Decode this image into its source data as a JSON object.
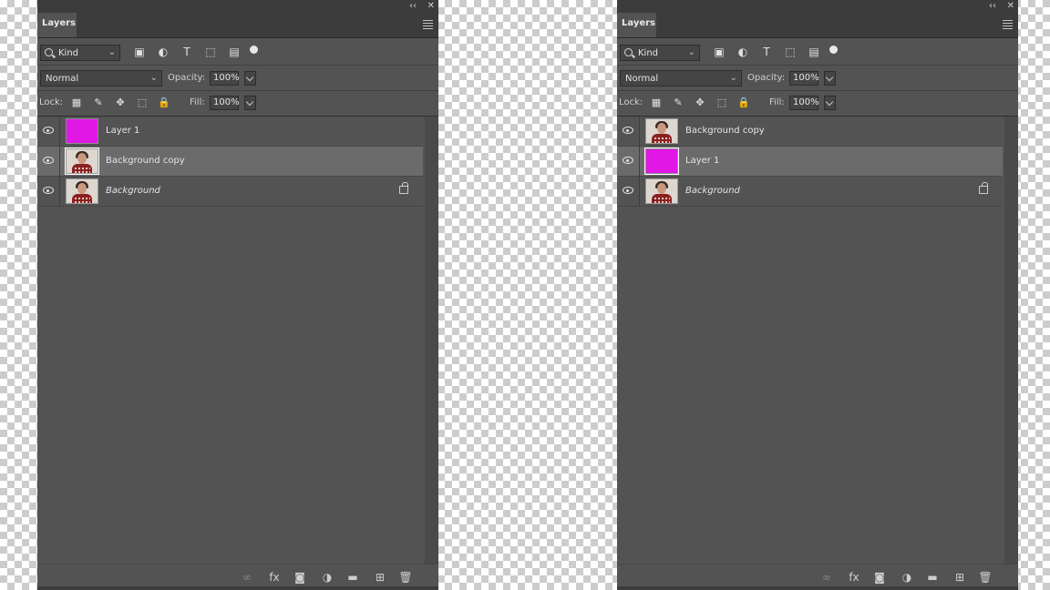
{
  "panels": [
    {
      "tab_label": "Layers",
      "collapse_glyph": "‹‹",
      "close_glyph": "✕",
      "filter": {
        "kind_label": "Kind"
      },
      "blend_mode": "Normal",
      "opacity_label": "Opacity:",
      "opacity_value": "100%",
      "lock_label": "Lock:",
      "fill_label": "Fill:",
      "fill_value": "100%",
      "layers": [
        {
          "name": "Layer 1",
          "thumb": "magenta",
          "selected": false,
          "italic": false,
          "locked": false
        },
        {
          "name": "Background copy",
          "thumb": "photo",
          "selected": true,
          "italic": false,
          "locked": false
        },
        {
          "name": "Background",
          "thumb": "photo",
          "selected": false,
          "italic": true,
          "locked": true
        }
      ]
    },
    {
      "tab_label": "Layers",
      "collapse_glyph": "‹‹",
      "close_glyph": "✕",
      "filter": {
        "kind_label": "Kind"
      },
      "blend_mode": "Normal",
      "opacity_label": "Opacity:",
      "opacity_value": "100%",
      "lock_label": "Lock:",
      "fill_label": "Fill:",
      "fill_value": "100%",
      "layers": [
        {
          "name": "Background copy",
          "thumb": "photo",
          "selected": false,
          "italic": false,
          "locked": false
        },
        {
          "name": "Layer 1",
          "thumb": "magenta",
          "selected": true,
          "italic": false,
          "locked": false
        },
        {
          "name": "Background",
          "thumb": "photo",
          "selected": false,
          "italic": true,
          "locked": true
        }
      ]
    }
  ],
  "filter_icons": [
    "image-filter-icon",
    "adjustment-filter-icon",
    "type-filter-icon",
    "shape-filter-icon",
    "smart-object-filter-icon"
  ],
  "lock_icons": [
    "lock-transparent-pixels-icon",
    "lock-image-pixels-icon",
    "lock-position-icon",
    "lock-artboard-icon",
    "lock-all-icon"
  ],
  "bottom_icons": [
    "link-layers-icon",
    "fx-icon",
    "add-mask-icon",
    "adjustment-layer-icon",
    "new-group-icon",
    "new-layer-icon",
    "delete-layer-icon"
  ],
  "colors": {
    "panel_bg": "#535353",
    "selected_row": "#6b6b6b",
    "magenta_fill": "#e117e6"
  }
}
